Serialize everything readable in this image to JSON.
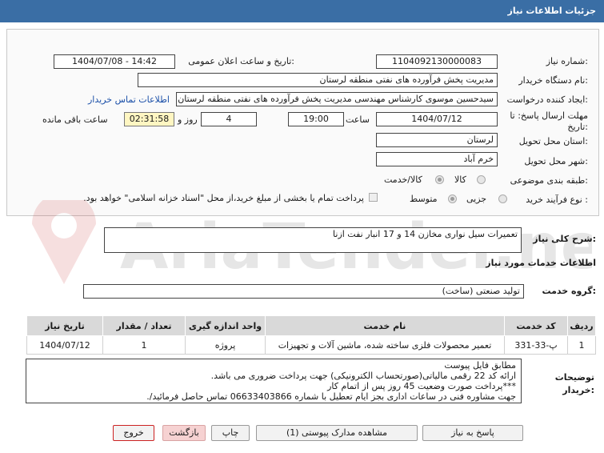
{
  "header": {
    "title": "جزئیات اطلاعات نیاز"
  },
  "form": {
    "need_number_label": "شماره نیاز:",
    "need_number": "1104092130000083",
    "announce_label": "تاریخ و ساعت اعلان عمومی:",
    "announce_value": "1404/07/08 - 14:42",
    "buyer_label": "نام دستگاه خریدار:",
    "buyer_value": "مدیریت پخش فرآورده های نفتی منطقه لرستان",
    "creator_label": "ایجاد کننده درخواست:",
    "creator_value": "سیدحسین موسوی کارشناس مهندسی مدیریت پخش فرآورده های نفتی منطقه لرستان",
    "contact_link": "اطلاعات تماس خریدار",
    "deadline_label": "مهلت ارسال پاسخ: تا تاریخ:",
    "deadline_date": "1404/07/12",
    "time_label": "ساعت",
    "deadline_time": "19:00",
    "days_value": "4",
    "days_label": "روز و",
    "remaining_time": "02:31:58",
    "remaining_label": "ساعت باقی مانده",
    "province_label": "استان محل تحویل:",
    "province_value": "لرستان",
    "city_label": "شهر محل تحویل:",
    "city_value": "خرم آباد",
    "category_label": "طبقه بندی موضوعی:",
    "category_options": [
      "کالا",
      "کالا/خدمت"
    ],
    "purchase_type_label": "نوع فرآیند خرید :",
    "purchase_type_options": [
      "جزیی",
      "متوسط"
    ],
    "payment_note": "پرداخت تمام یا بخشی از مبلغ خرید،از محل \"اسناد خزانه اسلامی\" خواهد بود."
  },
  "summary": {
    "label": "شرح کلی نیاز:",
    "value": "تعمیرات سیل نواری مخازن 14 و 17 انبار نفت ازنا"
  },
  "services": {
    "section_title": "اطلاعات خدمات مورد نیاز",
    "group_label": "گروه خدمت:",
    "group_value": "تولید صنعتی (ساخت)",
    "columns": [
      "ردیف",
      "کد خدمت",
      "نام خدمت",
      "واحد اندازه گیری",
      "تعداد / مقدار",
      "تاریخ نیاز"
    ],
    "rows": [
      [
        "1",
        "پ-33-331",
        "تعمیر محصولات فلزی ساخته شده، ماشین آلات و تجهیزات",
        "پروژه",
        "1",
        "1404/07/12"
      ]
    ]
  },
  "buyer_notes": {
    "label": "توضیحات خریدار:",
    "lines": [
      "مطابق فایل پیوست",
      "ارائه کد 22 رقمی مالیاتی(صورتحساب الکترونیکی) جهت پرداخت ضروری می باشد.",
      "***پرداخت صورت وضعیت 45 روز پس از اتمام کار",
      "جهت مشاوره فنی در ساعات اداری بجز ایام تعطیل با شماره 06633403866 تماس حاصل فرمائید/."
    ]
  },
  "buttons": {
    "reply": "پاسخ به نیاز",
    "attachments": "مشاهده مدارک پیوستی (1)",
    "print": "چاپ",
    "back": "بازگشت",
    "exit": "خروج"
  },
  "colors": {
    "header": "#3a6ea5",
    "link": "#1a4fa8",
    "timer": "#fff6c2",
    "watermark": "#c62828"
  }
}
